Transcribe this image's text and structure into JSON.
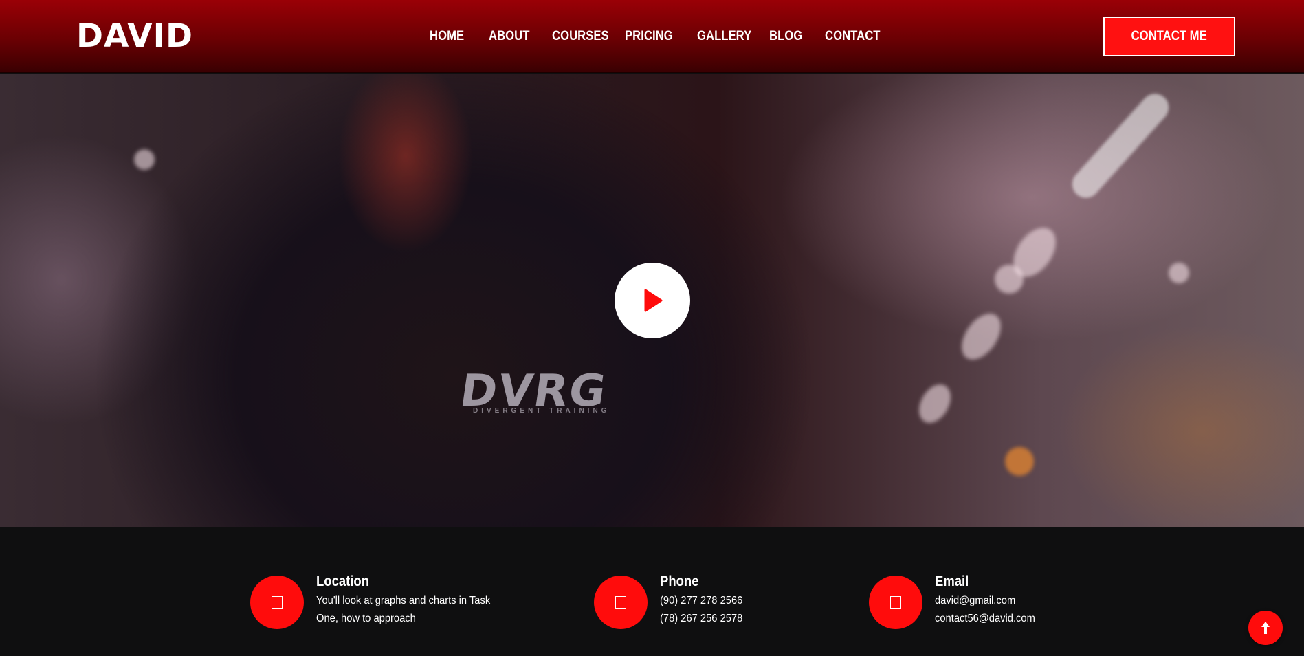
{
  "header": {
    "logo": "DAVID",
    "nav": [
      {
        "label": "HOME"
      },
      {
        "label": "ABOUT"
      },
      {
        "label": "COURSES"
      },
      {
        "label": "PRICING"
      },
      {
        "label": "GALLERY"
      },
      {
        "label": "BLOG"
      },
      {
        "label": "CONTACT"
      }
    ],
    "cta_label": "CONTACT ME"
  },
  "hero": {
    "play_icon": "play-icon",
    "jacket_logo": "DVRG",
    "jacket_sub": "DIVERGENT TRAINING"
  },
  "contact": [
    {
      "icon": "location-icon",
      "title": "Location",
      "lines": [
        "You'll look at graphs and charts in Task",
        "One, how to approach"
      ]
    },
    {
      "icon": "phone-icon",
      "title": "Phone",
      "lines": [
        "(90) 277 278 2566",
        "(78) 267 256 2578"
      ]
    },
    {
      "icon": "email-icon",
      "title": "Email",
      "lines": [
        "david@gmail.com",
        "contact56@david.com"
      ]
    }
  ],
  "back_to_top_icon": "arrow-up-icon",
  "colors": {
    "accent": "#ff0c0c",
    "header_top": "#9a0006",
    "header_bottom": "#3a0002",
    "footer_bg": "#0f0f10"
  }
}
